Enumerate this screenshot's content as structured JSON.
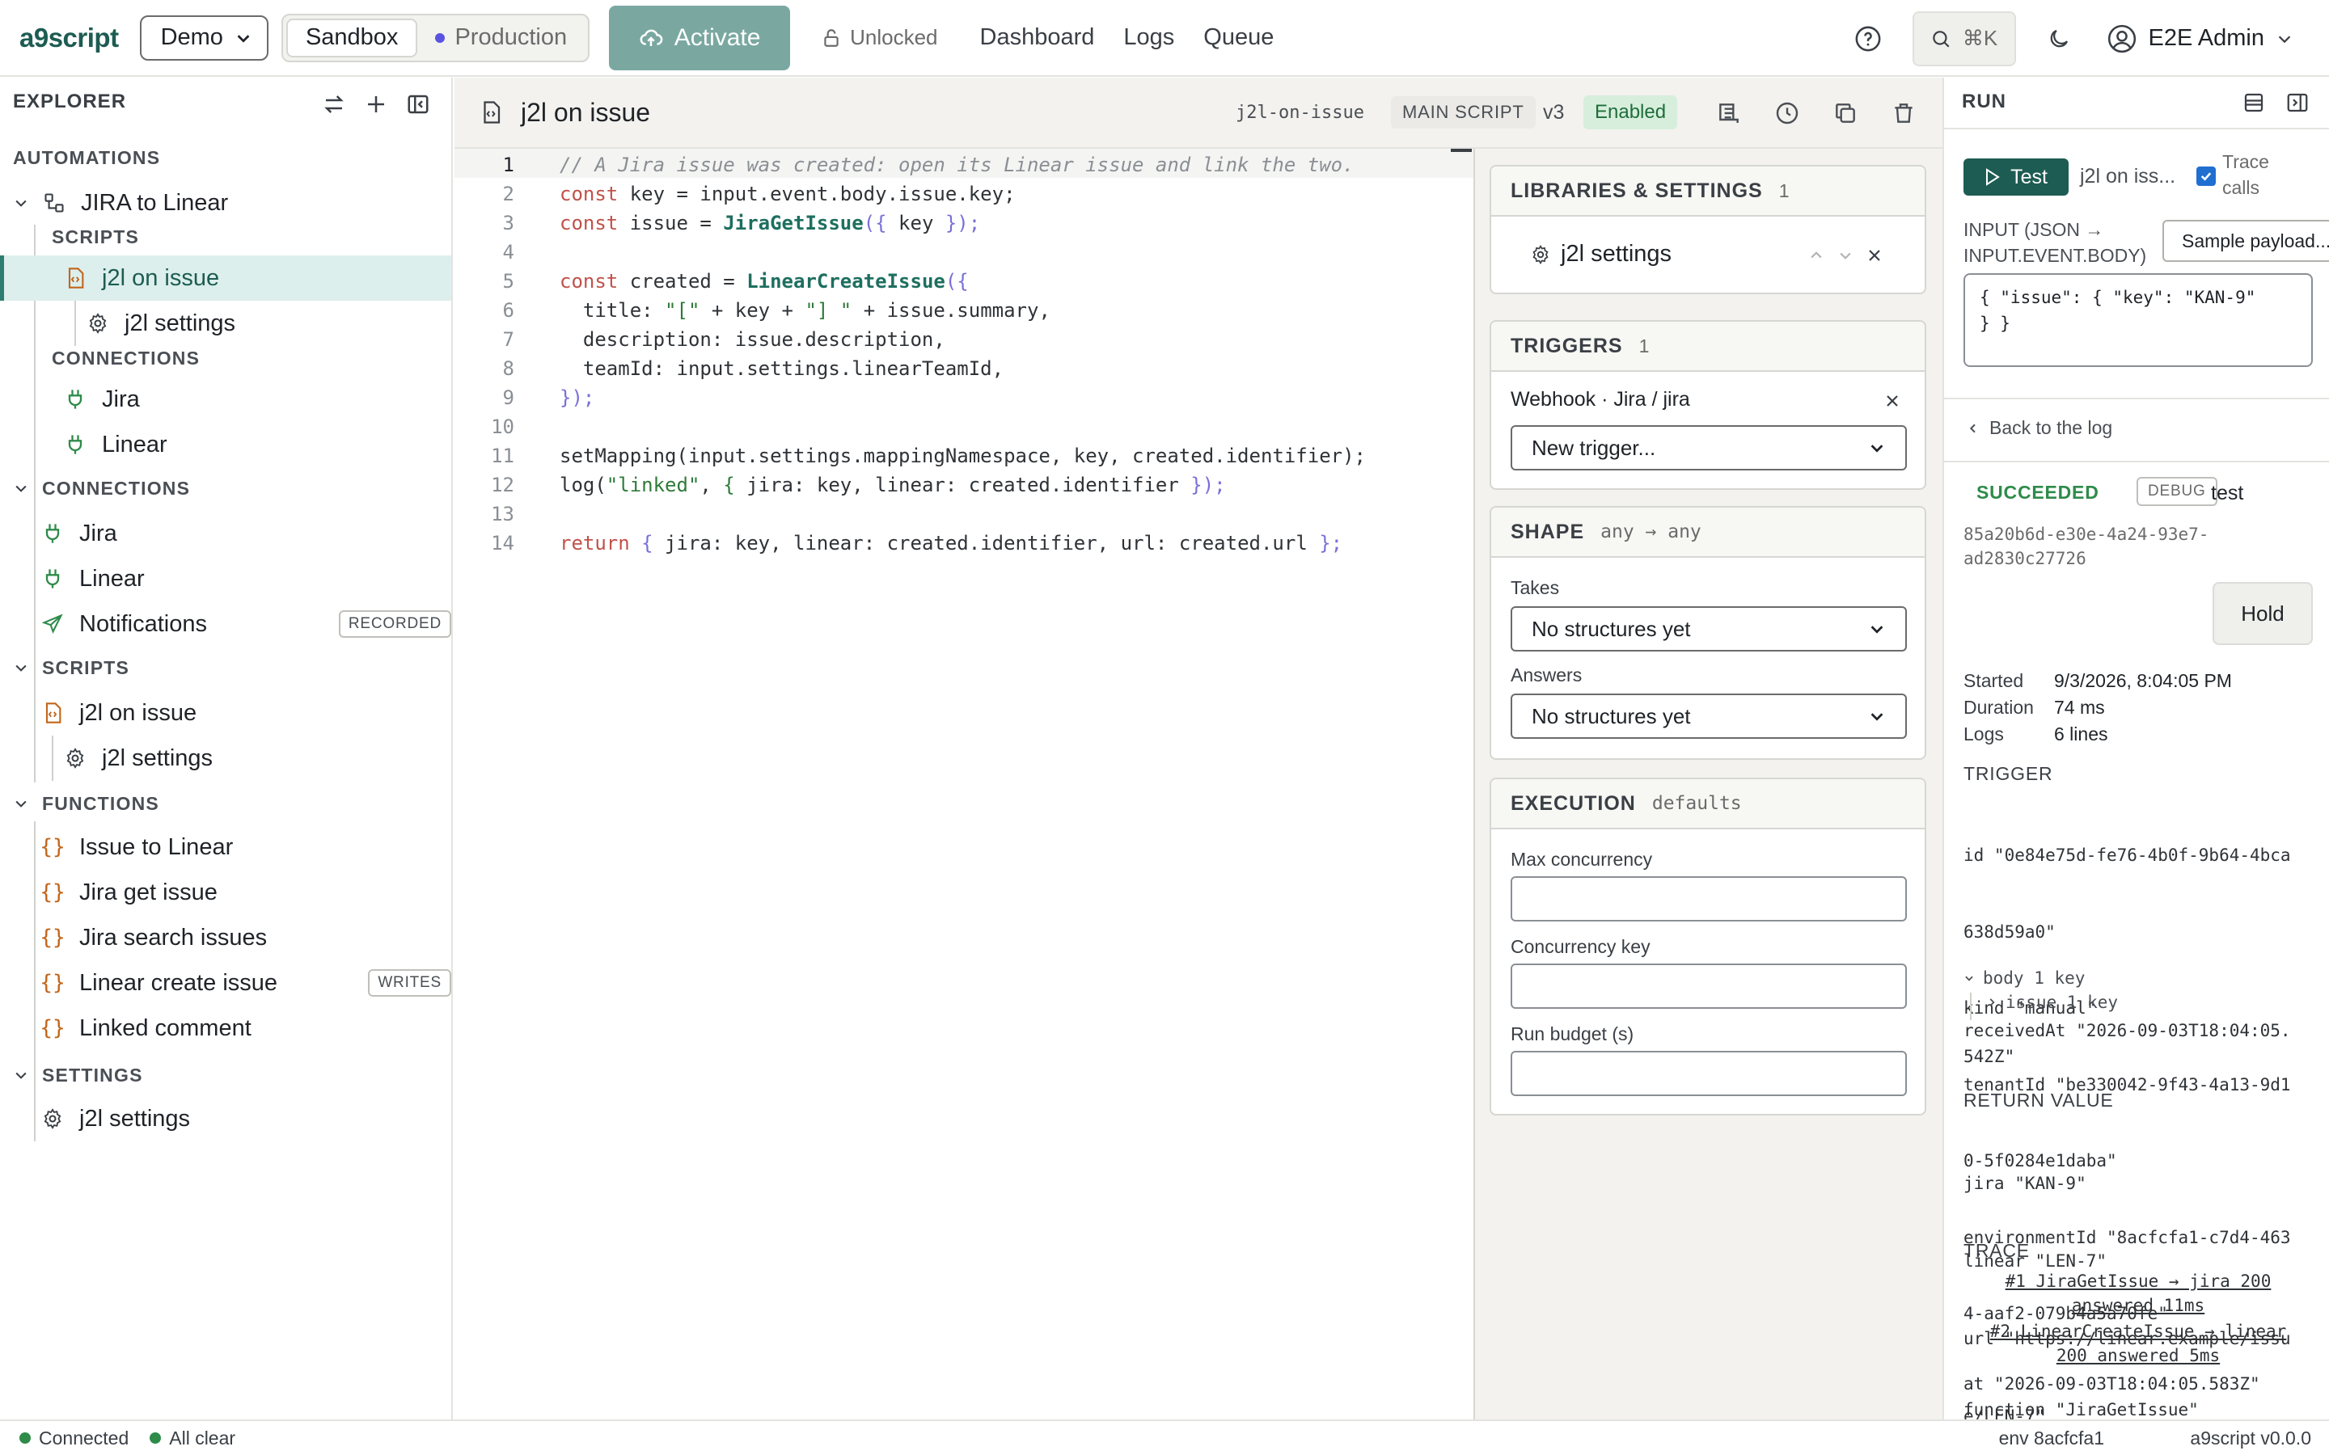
{
  "app": {
    "logo": "a9script"
  },
  "topbar": {
    "project_select": "Demo",
    "env_sandbox": "Sandbox",
    "env_production": "Production",
    "activate": "Activate",
    "lock_status": "Unlocked",
    "nav": [
      "Dashboard",
      "Logs",
      "Queue"
    ],
    "search_shortcut": "⌘K",
    "user_name": "E2E Admin"
  },
  "explorer": {
    "title": "EXPLORER",
    "automations_title": "AUTOMATIONS",
    "automation_name": "JIRA to Linear",
    "auto_scripts_title": "SCRIPTS",
    "auto_script_main": "j2l on issue",
    "auto_script_settings": "j2l settings",
    "auto_connections_title": "CONNECTIONS",
    "auto_conn_1": "Jira",
    "auto_conn_2": "Linear",
    "connections_title": "CONNECTIONS",
    "connections": [
      {
        "label": "Jira",
        "badge": ""
      },
      {
        "label": "Linear",
        "badge": ""
      },
      {
        "label": "Notifications",
        "badge": "RECORDED"
      }
    ],
    "scripts_title": "SCRIPTS",
    "script_main": "j2l on issue",
    "script_settings": "j2l settings",
    "functions_title": "FUNCTIONS",
    "functions": [
      {
        "label": "Issue to Linear",
        "badge": ""
      },
      {
        "label": "Jira get issue",
        "badge": ""
      },
      {
        "label": "Jira search issues",
        "badge": ""
      },
      {
        "label": "Linear create issue",
        "badge": "WRITES"
      },
      {
        "label": "Linked comment",
        "badge": ""
      }
    ],
    "settings_title": "SETTINGS",
    "settings_item": "j2l settings"
  },
  "editor": {
    "title": "j2l on issue",
    "slug": "j2l-on-issue",
    "kind": "MAIN SCRIPT",
    "version": "v3",
    "status": "Enabled",
    "lines": [
      "1",
      "2",
      "3",
      "4",
      "5",
      "6",
      "7",
      "8",
      "9",
      "10",
      "11",
      "12",
      "13",
      "14"
    ],
    "code": {
      "l1": "// A Jira issue was created: open its Linear issue and link the two.",
      "l2_a": "const",
      "l2_b": " key = input.event.body.issue.key;",
      "l3_a": "const",
      "l3_b": " issue = ",
      "l3_c": "JiraGetIssue",
      "l3_d": "({",
      "l3_e": " key ",
      "l3_f": "});",
      "l5_a": "const",
      "l5_b": " created = ",
      "l5_c": "LinearCreateIssue",
      "l5_d": "({",
      "l6_a": "  title: ",
      "l6_b": "\"[\"",
      "l6_c": " + key + ",
      "l6_d": "\"] \"",
      "l6_e": " + issue.summary,",
      "l7": "  description: issue.description,",
      "l8": "  teamId: input.settings.linearTeamId,",
      "l9_a": "});",
      "l11": "setMapping(input.settings.mappingNamespace, key, created.identifier);",
      "l12_a": "log(",
      "l12_b": "\"linked\"",
      "l12_c": ", ",
      "l12_d": "{",
      "l12_e": " jira: key, linear: created.identifier ",
      "l12_f": "});",
      "l14_a": "return",
      "l14_b": " ",
      "l14_c": "{",
      "l14_d": " jira: key, linear: created.identifier, url: created.url ",
      "l14_e": "};"
    }
  },
  "settings_panel": {
    "libraries_title": "LIBRARIES & SETTINGS",
    "libraries_count": "1",
    "library_item": "j2l settings",
    "triggers_title": "TRIGGERS",
    "triggers_count": "1",
    "trigger_item": "Webhook · Jira / jira",
    "new_trigger": "New trigger...",
    "shape_title": "SHAPE",
    "shape_sub": "any → any",
    "takes_label": "Takes",
    "takes_value": "No structures yet",
    "answers_label": "Answers",
    "answers_value": "No structures yet",
    "execution_title": "EXECUTION",
    "execution_sub": "defaults",
    "max_concurrency_label": "Max concurrency",
    "concurrency_key_label": "Concurrency key",
    "run_budget_label": "Run budget (s)"
  },
  "run_panel": {
    "title": "RUN",
    "test_button": "Test",
    "script_name": "j2l on iss...",
    "trace_calls_1": "Trace",
    "trace_calls_2": "calls",
    "input_label_1": "INPUT (JSON →",
    "input_label_2": "INPUT.EVENT.BODY)",
    "sample_payload": "Sample payload...",
    "input_value_1": "{ \"issue\": { \"key\": \"KAN-9\"",
    "input_value_2": "} }",
    "back_link": "Back to the log",
    "result_status": "SUCCEEDED",
    "result_mode": "DEBUG",
    "result_env": "test",
    "run_id_1": "85a20b6d-e30e-4a24-93e7-",
    "run_id_2": "ad2830c27726",
    "hold_button": "Hold",
    "started_label": "Started",
    "started_value": "9/3/2026, 8:04:05 PM",
    "duration_label": "Duration",
    "duration_value": "74 ms",
    "logs_label": "Logs",
    "logs_value": "6 lines",
    "trigger_title": "TRIGGER",
    "trigger_lines": [
      "id \"0e84e75d-fe76-4b0f-9b64-4bca",
      "638d59a0\"",
      "kind \"manual\"",
      "tenantId \"be330042-9f43-4a13-9d1",
      "0-5f0284e1daba\"",
      "environmentId \"8acfcfa1-c7d4-463",
      "4-aaf2-079b4a5a70fe\""
    ],
    "body_line": "body 1 key",
    "issue_line": "issue 1 key",
    "received_1": "receivedAt \"2026-09-03T18:04:05.",
    "received_2": "542Z\"",
    "return_title": "RETURN VALUE",
    "return_lines": [
      "jira \"KAN-9\"",
      "linear \"LEN-7\"",
      "url \"https://linear.example/issu",
      "e/LEN-7\""
    ],
    "trace_title": "TRACE",
    "trace_1a": "#1 JiraGetIssue → jira 200",
    "trace_1b": "answered 11ms",
    "trace_2a": "#2 LinearCreateIssue → linear",
    "trace_2b": "200 answered 5ms",
    "trace_at": "at \"2026-09-03T18:04:05.583Z\"",
    "trace_fn": "function \"JiraGetIssue\""
  },
  "statusbar": {
    "connected": "Connected",
    "all_clear": "All clear",
    "env": "env 8acfcfa1",
    "version": "a9script v0.0.0"
  },
  "colors": {
    "brand": "#1d5c52",
    "accent": "#2e7d70",
    "activate": "#7aa8a1",
    "success": "#2e8b4a",
    "selected_row": "#dcefed"
  },
  "icons": [
    "help-icon",
    "search-icon",
    "moon-icon",
    "user-icon",
    "chevron-down-icon",
    "swap-icon",
    "plus-icon",
    "collapse-icon",
    "script-file-icon",
    "gear-icon",
    "plug-icon",
    "send-icon",
    "braces-icon",
    "flow-icon",
    "outline-icon",
    "history-icon",
    "copy-icon",
    "trash-icon",
    "close-icon",
    "play-icon",
    "layout-icon",
    "cloud-upload-icon",
    "lock-icon"
  ]
}
